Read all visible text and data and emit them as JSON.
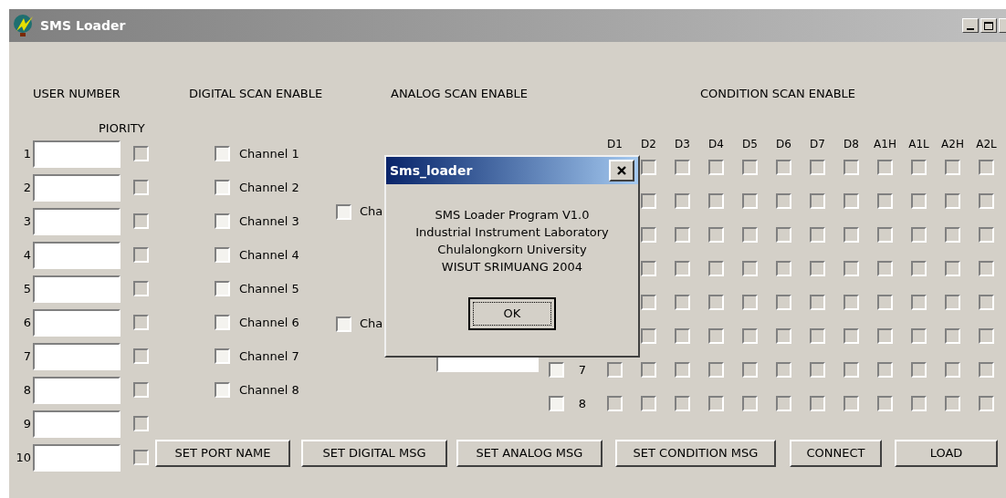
{
  "window": {
    "title": "SMS Loader"
  },
  "headings": [
    "USER NUMBER",
    "DIGITAL SCAN ENABLE",
    "ANALOG SCAN ENABLE",
    "CONDITION SCAN ENABLE"
  ],
  "priority_label": "PIORITY",
  "users": [
    {
      "number": "1",
      "priority": {
        "checked": false,
        "disabled": true
      }
    },
    {
      "number": "2",
      "priority": {
        "checked": false,
        "disabled": true
      }
    },
    {
      "number": "3",
      "priority": {
        "checked": false,
        "disabled": true
      }
    },
    {
      "number": "4",
      "priority": {
        "checked": false,
        "disabled": true
      }
    },
    {
      "number": "5",
      "priority": {
        "checked": false,
        "disabled": true
      }
    },
    {
      "number": "6",
      "priority": {
        "checked": false,
        "disabled": true
      }
    },
    {
      "number": "7",
      "priority": {
        "checked": false,
        "disabled": true
      }
    },
    {
      "number": "8",
      "priority": {
        "checked": false,
        "disabled": true
      }
    },
    {
      "number": "9",
      "priority": {
        "checked": false,
        "disabled": true
      }
    },
    {
      "number": "10",
      "priority": {
        "checked": false,
        "disabled": true
      }
    }
  ],
  "digital_channels": [
    {
      "label": "Channel 1",
      "checked": false
    },
    {
      "label": "Channel 2",
      "checked": false
    },
    {
      "label": "Channel 3",
      "checked": false
    },
    {
      "label": "Channel 4",
      "checked": false
    },
    {
      "label": "Channel 5",
      "checked": false
    },
    {
      "label": "Channel 6",
      "checked": false
    },
    {
      "label": "Channel 7",
      "checked": false
    },
    {
      "label": "Channel 8",
      "checked": false
    }
  ],
  "analog_channels": [
    {
      "label": "Cha",
      "checked": false
    },
    {
      "label": "Cha",
      "checked": false
    }
  ],
  "condition": {
    "columns": [
      "D1",
      "D2",
      "D3",
      "D4",
      "D5",
      "D6",
      "D7",
      "D8",
      "A1H",
      "A1L",
      "A2H",
      "A2L"
    ],
    "rows": [
      {
        "cells": [
          false,
          false,
          false,
          false,
          false,
          false,
          false,
          false,
          false,
          false,
          false
        ]
      },
      {
        "cells": [
          false,
          false,
          false,
          false,
          false,
          false,
          false,
          false,
          false,
          false,
          false
        ]
      },
      {
        "cells": [
          false,
          false,
          false,
          false,
          false,
          false,
          false,
          false,
          false,
          false,
          false
        ]
      },
      {
        "cells": [
          false,
          false,
          false,
          false,
          false,
          false,
          false,
          false,
          false,
          false,
          false
        ]
      },
      {
        "cells": [
          false,
          false,
          false,
          false,
          false,
          false,
          false,
          false,
          false,
          false,
          false
        ]
      },
      {
        "cells": [
          false,
          false,
          false,
          false,
          false,
          false,
          false,
          false,
          false,
          false,
          false
        ]
      },
      {
        "number": "7",
        "enabled": false,
        "cells": [
          false,
          false,
          false,
          false,
          false,
          false,
          false,
          false,
          false,
          false,
          false,
          false
        ]
      },
      {
        "number": "8",
        "enabled": false,
        "cells": [
          false,
          false,
          false,
          false,
          false,
          false,
          false,
          false,
          false,
          false,
          false,
          false
        ]
      }
    ]
  },
  "buttons": [
    "SET PORT NAME",
    "SET DIGITAL MSG",
    "SET ANALOG MSG",
    "SET CONDITION MSG",
    "CONNECT",
    "LOAD"
  ],
  "dialog": {
    "title": "Sms_loader",
    "lines": [
      "SMS Loader Program V1.0",
      "Industrial Instrument Laboratory",
      "Chulalongkorn University",
      "WISUT SRIMUANG 2004"
    ],
    "button": "OK"
  }
}
